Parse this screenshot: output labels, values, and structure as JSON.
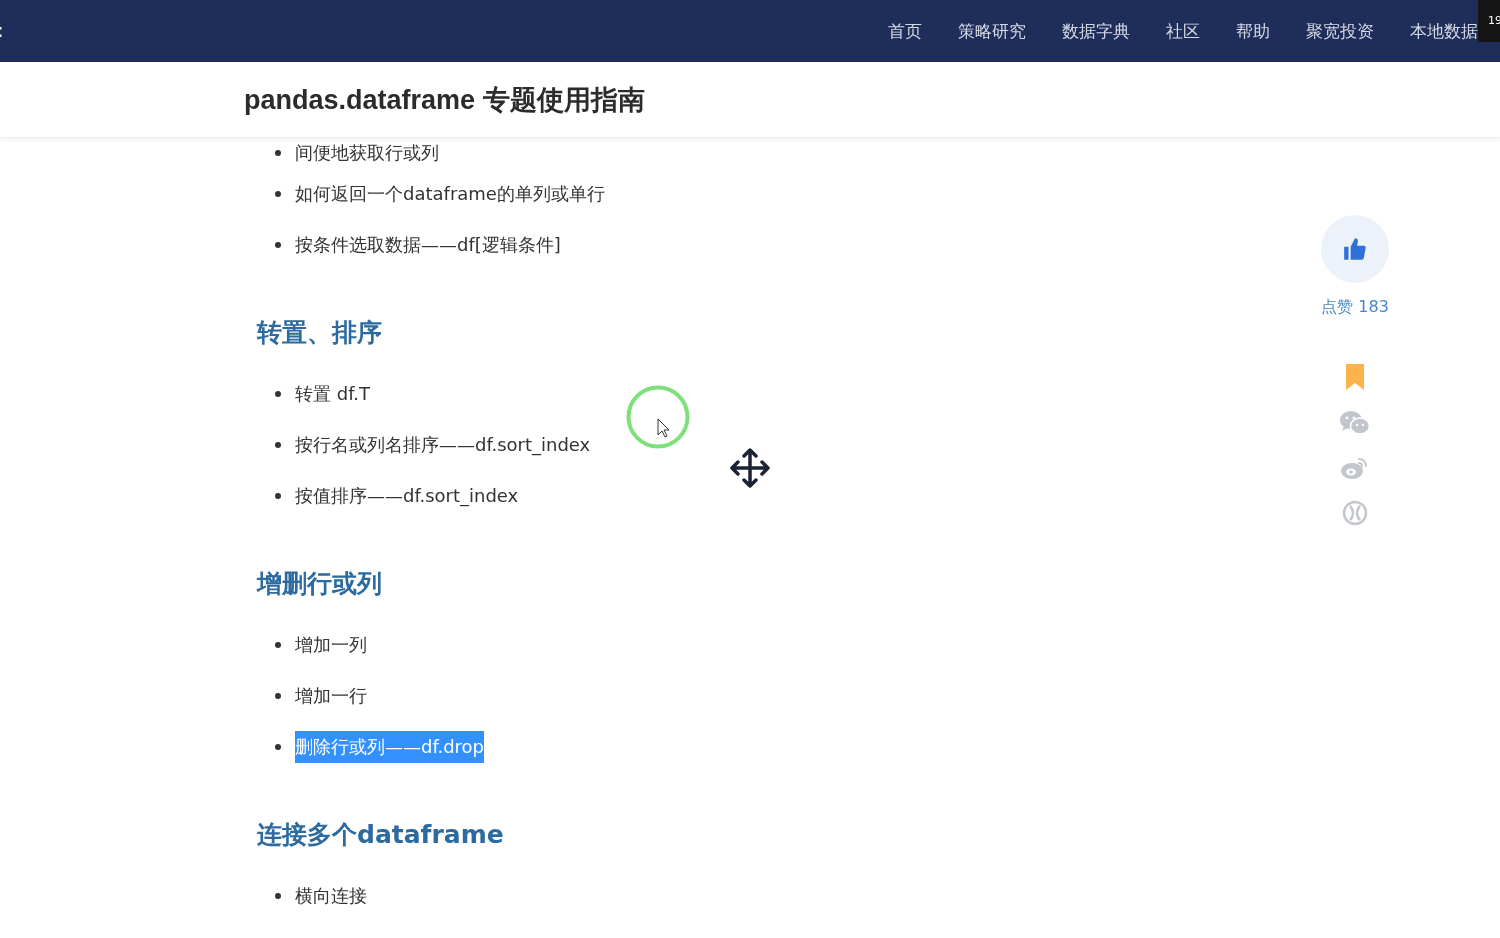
{
  "nav": {
    "edge_glyph": ":",
    "items": [
      "首页",
      "策略研究",
      "数据字典",
      "社区",
      "帮助",
      "聚宽投资",
      "本地数据"
    ],
    "corner_badge": "19"
  },
  "page": {
    "title": "pandas.dataframe 专题使用指南"
  },
  "sections": [
    {
      "items": [
        {
          "text": "间便地获取行或列",
          "highlighted": false
        },
        {
          "text": "如何返回一个dataframe的单列或单行",
          "highlighted": false
        },
        {
          "text": "按条件选取数据——df[逻辑条件]",
          "highlighted": false
        }
      ]
    },
    {
      "heading": "转置、排序",
      "items": [
        {
          "text": "转置 df.T",
          "highlighted": false
        },
        {
          "text": "按行名或列名排序——df.sort_index",
          "highlighted": false
        },
        {
          "text": "按值排序——df.sort_index",
          "highlighted": false
        }
      ]
    },
    {
      "heading": "增删行或列",
      "items": [
        {
          "text": "增加一列",
          "highlighted": false
        },
        {
          "text": "增加一行",
          "highlighted": false
        },
        {
          "text": "删除行或列——df.drop",
          "highlighted": true
        }
      ]
    },
    {
      "heading": "连接多个dataframe",
      "items": [
        {
          "text": "横向连接",
          "highlighted": false
        }
      ]
    }
  ],
  "sidebar": {
    "like_label": "点赞 183"
  }
}
